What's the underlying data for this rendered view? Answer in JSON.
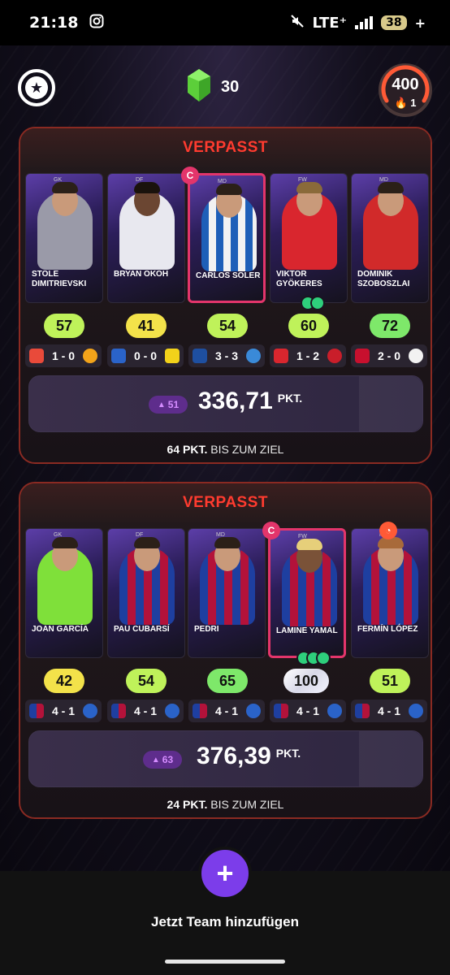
{
  "status_bar": {
    "time": "21:18",
    "network": "LTE⁺",
    "battery": "38"
  },
  "header": {
    "gem_count": "30",
    "points": "400",
    "streak": "1"
  },
  "teams": [
    {
      "header": "VERPASST",
      "players": [
        {
          "name": "STOLE DIMITRIEVSKI",
          "pos": "GK"
        },
        {
          "name": "BRYAN OKOH",
          "pos": "DF"
        },
        {
          "name": "CARLOS SOLER",
          "pos": "MD"
        },
        {
          "name": "VIKTOR GYÖKERES",
          "pos": "FW"
        },
        {
          "name": "DOMINIK SZOBOSZLAI",
          "pos": "MD"
        }
      ],
      "scores": [
        "57",
        "41",
        "54",
        "60",
        "72"
      ],
      "results": [
        "1 - 0",
        "0 - 0",
        "3 - 3",
        "1 - 2",
        "2 - 0"
      ],
      "delta": "51",
      "total": "336,71",
      "pkt": "PKT.",
      "goal_points": "64 PKT.",
      "goal_text": "BIS ZUM ZIEL"
    },
    {
      "header": "VERPASST",
      "players": [
        {
          "name": "JOAN GARCÍA",
          "pos": "GK"
        },
        {
          "name": "PAU CUBARSÍ",
          "pos": "DF"
        },
        {
          "name": "PEDRI",
          "pos": "MD"
        },
        {
          "name": "LAMINE YAMAL",
          "pos": "FW"
        },
        {
          "name": "FERMÍN LÓPEZ",
          "pos": "MD"
        }
      ],
      "scores": [
        "42",
        "54",
        "65",
        "100",
        "51"
      ],
      "results": [
        "4 - 1",
        "4 - 1",
        "4 - 1",
        "4 - 1",
        "4 - 1"
      ],
      "delta": "63",
      "total": "376,39",
      "pkt": "PKT.",
      "goal_points": "24 PKT.",
      "goal_text": "BIS ZUM ZIEL"
    }
  ],
  "captain_badge": "C",
  "add_team_label": "Jetzt Team hinzufügen",
  "icons": {
    "gem": "gem-icon",
    "star": "star-icon",
    "flame": "flame-icon",
    "plus": "plus-icon"
  },
  "colors": {
    "accent_red": "#ff3b2f",
    "accent_purple": "#7c3dea",
    "score_yellow": "#f3e24a",
    "score_green": "#bff25a",
    "score_bright_green": "#7ee86a"
  }
}
